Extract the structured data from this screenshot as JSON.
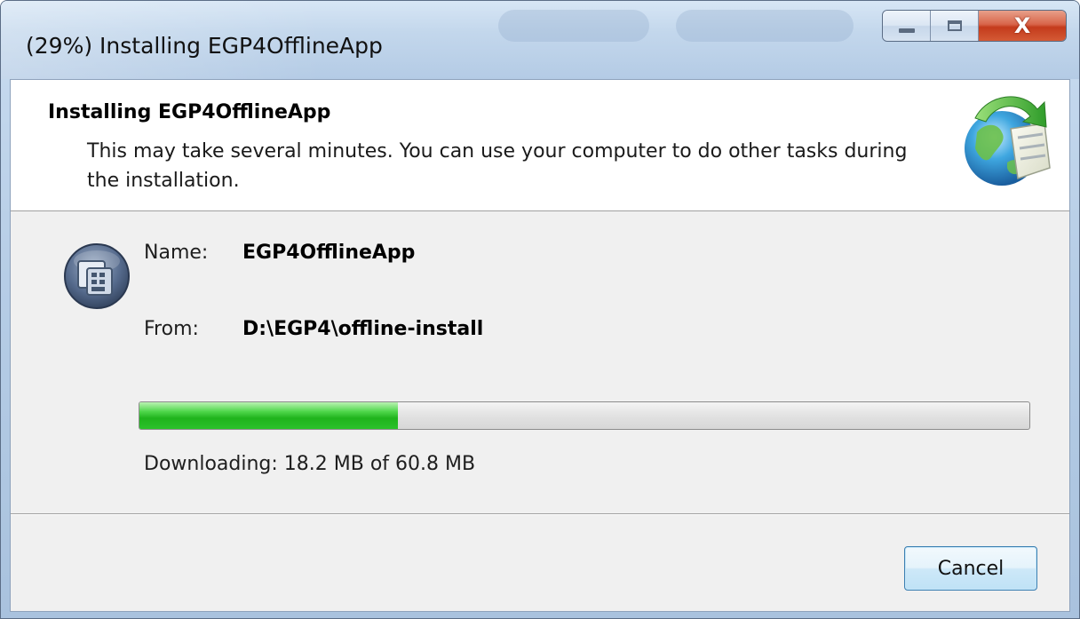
{
  "window": {
    "title": "(29%) Installing EGP4OfflineApp"
  },
  "caption_buttons": {
    "minimize_icon": "minimize-icon",
    "maximize_icon": "maximize-icon",
    "close_label": "X"
  },
  "header": {
    "title": "Installing EGP4OfflineApp",
    "description": "This may take several minutes. You can use your computer to do other tasks during the installation.",
    "icon": "globe-install-icon"
  },
  "details": {
    "app_icon": "app-icon",
    "name_label": "Name:",
    "name_value": "EGP4OfflineApp",
    "from_label": "From:",
    "from_value": "D:\\EGP4\\offline-install"
  },
  "progress": {
    "fraction": 0.29,
    "status": "Downloading: 18.2 MB of 60.8 MB"
  },
  "footer": {
    "cancel_label": "Cancel"
  },
  "colors": {
    "progress_fill": "#1fb31c",
    "header_background": "#ffffff",
    "body_background": "#f0f0f0",
    "close_button": "#c43b1c"
  }
}
